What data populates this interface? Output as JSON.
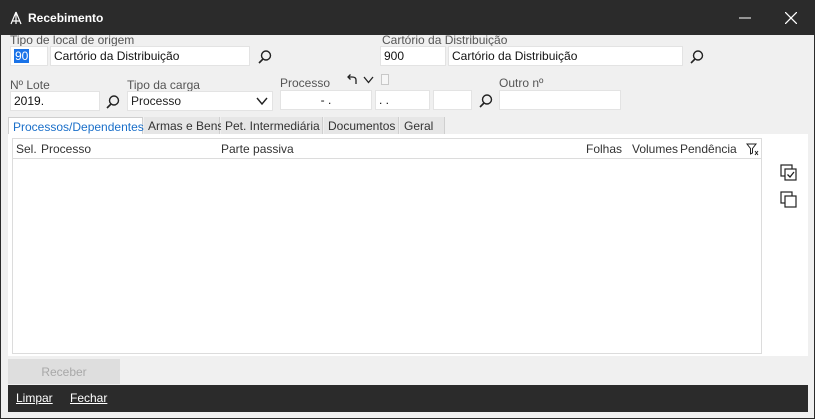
{
  "window": {
    "title": "Recebimento"
  },
  "origin": {
    "label": "Tipo de local de origem",
    "code_value": "90",
    "name_value": "Cartório da Distribuição"
  },
  "destination": {
    "label": "Cartório da Distribuição",
    "code_value": "900",
    "name_value": "Cartório da Distribuição"
  },
  "lote": {
    "label": "Nº Lote",
    "value": "2019."
  },
  "carga": {
    "label": "Tipo da carga",
    "value": "Processo"
  },
  "processo": {
    "label": "Processo",
    "part1": "-  .",
    "part2": ".  .",
    "part3": ""
  },
  "outro": {
    "label": "Outro nº",
    "value": ""
  },
  "tabs": [
    {
      "label": "Processos/Dependentes"
    },
    {
      "label": "Armas e Bens"
    },
    {
      "label": "Pet. Intermediária"
    },
    {
      "label": "Documentos"
    },
    {
      "label": "Geral"
    }
  ],
  "grid": {
    "columns": [
      "Sel.",
      "Processo",
      "Parte passiva",
      "Folhas",
      "Volumes",
      "Pendência"
    ]
  },
  "actions": {
    "receber": "Receber"
  },
  "footer": {
    "limpar": "Limpar",
    "fechar": "Fechar"
  },
  "colors": {
    "titlebar": "#2b2b2b",
    "accent": "#1a6fc9",
    "selection": "#1a73e8"
  },
  "icons": [
    "app-icon",
    "minimize-icon",
    "close-icon",
    "search-icon",
    "chevron-down-icon",
    "undo-icon",
    "filter-icon",
    "check-all-icon",
    "copy-icon"
  ]
}
